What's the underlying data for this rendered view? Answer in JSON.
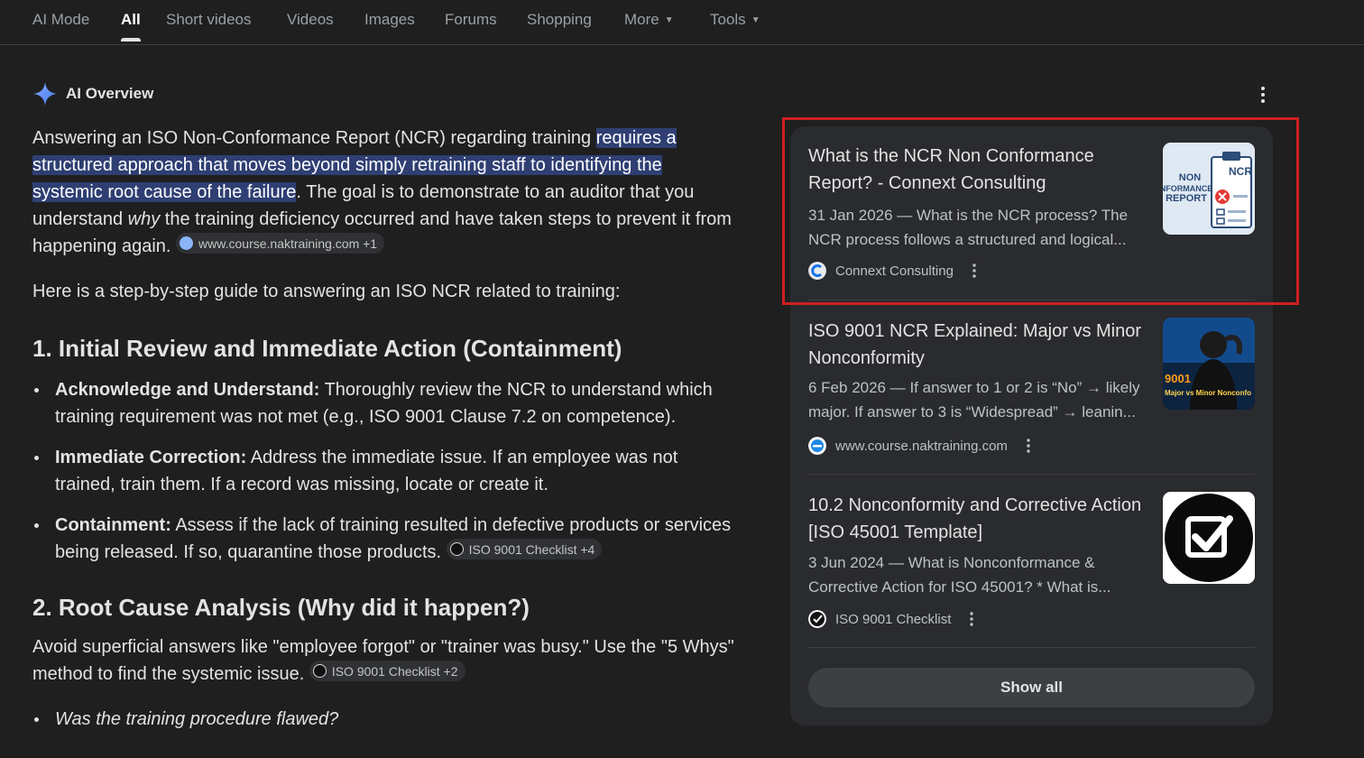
{
  "tabs": [
    {
      "label": "AI Mode"
    },
    {
      "label": "All",
      "active": true
    },
    {
      "label": "Short videos"
    },
    {
      "label": "Videos"
    },
    {
      "label": "Images"
    },
    {
      "label": "Forums"
    },
    {
      "label": "Shopping"
    },
    {
      "label": "More",
      "dropdown": true
    },
    {
      "label": "Tools",
      "dropdown": true
    }
  ],
  "ai_overview": {
    "title": "AI Overview",
    "intro": {
      "t1": "Answering an ISO Non-Conformance Report (NCR) regarding training ",
      "highlight_1": "requires a",
      "highlight_2": "structured approach that moves beyond simply retraining staff to identifying the",
      "highlight_3": "systemic root cause of the failure",
      "t2": ". The goal is to demonstrate to an auditor that you understand ",
      "em": "why",
      "t3": " the training deficiency occurred and have taken steps to prevent it from happening again.",
      "chip": "www.course.naktraining.com +1"
    },
    "guide_line": "Here is a step-by-step guide to answering an ISO NCR related to training:",
    "section1": {
      "heading": "1. Initial Review and Immediate Action (Containment)",
      "bullets": [
        {
          "bold": "Acknowledge and Understand:",
          "text": " Thoroughly review the NCR to understand which training requirement was not met (e.g., ISO 9001 Clause 7.2 on competence)."
        },
        {
          "bold": "Immediate Correction:",
          "text": " Address the immediate issue. If an employee was not trained, train them. If a record was missing, locate or create it."
        },
        {
          "bold": "Containment:",
          "text": " Assess if the lack of training resulted in defective products or services being released. If so, quarantine those products.",
          "chip": "ISO 9001 Checklist +4"
        }
      ]
    },
    "section2": {
      "heading": "2. Root Cause Analysis (Why did it happen?)",
      "para": "Avoid superficial answers like \"employee forgot\" or \"trainer was busy.\" Use the \"5 Whys\" method to find the systemic issue.",
      "chip": "ISO 9001 Checklist +2",
      "bullet_italic": "Was the training procedure flawed?"
    }
  },
  "sources": {
    "cards": [
      {
        "title": "What is the NCR Non Conformance Report? - Connext Consulting",
        "snippet": "31 Jan 2026 — What is the NCR process? The NCR process follows a structured and logical...",
        "source": "Connext Consulting",
        "thumb_text_1": "NON",
        "thumb_text_2": "NFORMANCE",
        "thumb_text_3": "REPORT",
        "thumb_text_4": "NCR"
      },
      {
        "title": "ISO 9001 NCR Explained: Major vs Minor Nonconformity",
        "snippet": "6 Feb 2026 — If answer to 1 or 2 is “No” → likely major. If answer to 3 is “Widespread” → leanin...",
        "source": "www.course.naktraining.com",
        "thumb_text_1": "9001",
        "thumb_text_2": "Major vs Minor Nonconfo"
      },
      {
        "title": "10.2 Nonconformity and Corrective Action [ISO 45001 Template]",
        "snippet": "3 Jun 2024 — What is Nonconformance & Corrective Action for ISO 45001? * What is...",
        "source": "ISO 9001 Checklist"
      }
    ],
    "show_all": "Show all"
  },
  "colors": {
    "background": "#1f1f1f",
    "panel": "#2a2b2e",
    "highlight": "#2f3f73",
    "annotation_box": "#d01f1f"
  }
}
